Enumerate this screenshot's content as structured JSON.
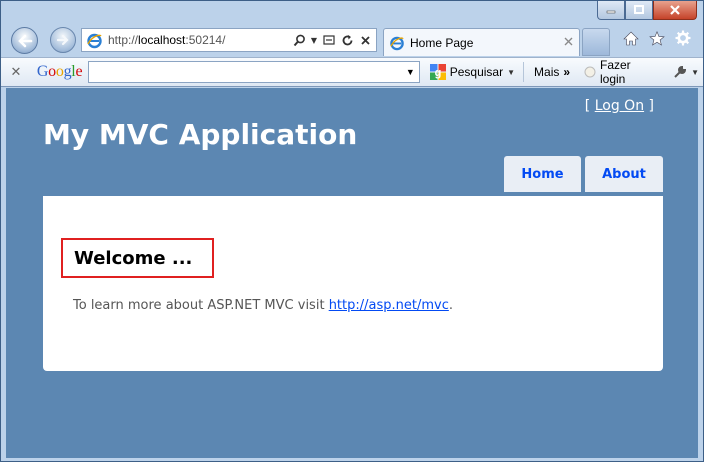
{
  "browser": {
    "address_host": "localhost",
    "address_prefix": "http://",
    "address_suffix": ":50214/",
    "tab_title": "Home Page"
  },
  "google_toolbar": {
    "logo_letters": [
      "G",
      "o",
      "o",
      "g",
      "l",
      "e"
    ],
    "search_value": "",
    "search_label": "Pesquisar",
    "more_label": "Mais",
    "more_chevrons": "»",
    "login_label": "Fazer login"
  },
  "site": {
    "logon_open": "[",
    "logon_label": "Log On",
    "logon_close": "]",
    "title": "My MVC Application",
    "menu": [
      {
        "label": "Home"
      },
      {
        "label": "About"
      }
    ],
    "heading": "Welcome ...",
    "learn_text": "To learn more about ASP.NET MVC visit",
    "learn_link": "http://asp.net/mvc",
    "learn_end": "."
  },
  "colors": {
    "page_background": "#5c87b2",
    "link": "#034af3",
    "highlight_border": "#e02020"
  }
}
